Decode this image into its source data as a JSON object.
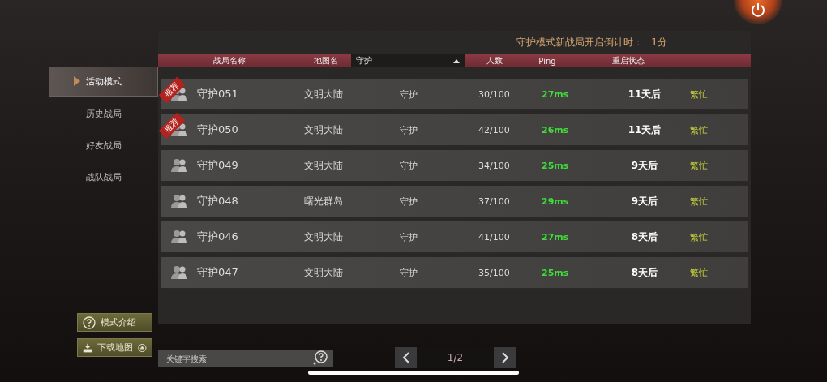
{
  "countdown": {
    "label": "守护模式新战局开启倒计时：",
    "value": "1分"
  },
  "sidebar": {
    "items": [
      {
        "label": "活动模式",
        "selected": true
      },
      {
        "label": "历史战局",
        "selected": false
      },
      {
        "label": "好友战局",
        "selected": false
      },
      {
        "label": "战队战局",
        "selected": false
      }
    ]
  },
  "table": {
    "columns": [
      "战局名称",
      "地图名"
    ],
    "mode_filter": {
      "value": "守护"
    },
    "columns_after": [
      "人数",
      "Ping",
      "重启状态"
    ],
    "rows": [
      {
        "badge": "推荐",
        "name": "守护051",
        "map": "文明大陆",
        "mode": "守护",
        "players": "30/100",
        "ping": "27ms",
        "restart": "11天后",
        "status": "繁忙"
      },
      {
        "badge": "推荐",
        "name": "守护050",
        "map": "文明大陆",
        "mode": "守护",
        "players": "42/100",
        "ping": "26ms",
        "restart": "11天后",
        "status": "繁忙"
      },
      {
        "name": "守护049",
        "map": "文明大陆",
        "mode": "守护",
        "players": "34/100",
        "ping": "25ms",
        "restart": "9天后",
        "status": "繁忙"
      },
      {
        "name": "守护048",
        "map": "曙光群岛",
        "mode": "守护",
        "players": "37/100",
        "ping": "29ms",
        "restart": "9天后",
        "status": "繁忙"
      },
      {
        "name": "守护046",
        "map": "文明大陆",
        "mode": "守护",
        "players": "41/100",
        "ping": "27ms",
        "restart": "8天后",
        "status": "繁忙"
      },
      {
        "name": "守护047",
        "map": "文明大陆",
        "mode": "守护",
        "players": "35/100",
        "ping": "25ms",
        "restart": "8天后",
        "status": "繁忙"
      }
    ]
  },
  "buttons": {
    "mode_intro": "模式介绍",
    "download_map": "下载地图"
  },
  "search": {
    "placeholder": "关键字搜索"
  },
  "pagination": {
    "page": "1/2"
  }
}
